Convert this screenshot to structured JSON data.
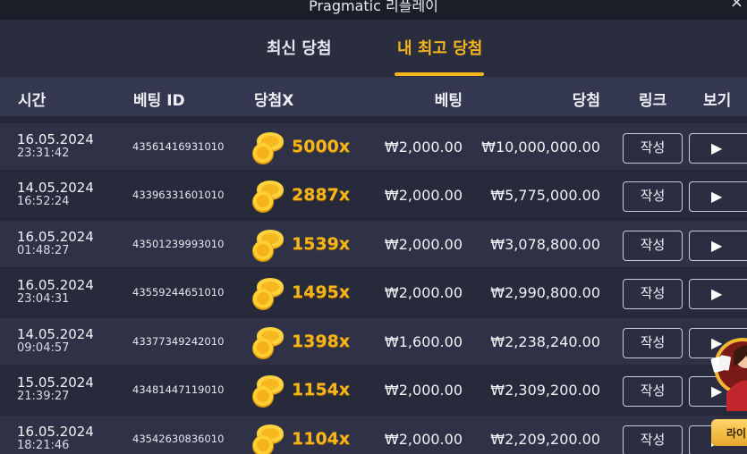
{
  "window": {
    "title": "Pragmatic 리플레이",
    "close_glyph": "×"
  },
  "tabs": [
    {
      "label": "최신 당첨",
      "active": false
    },
    {
      "label": "내 최고 당첨",
      "active": true
    }
  ],
  "columns": {
    "time": "시간",
    "bet_id": "베팅 ID",
    "multiplier": "당첨X",
    "bet": "베팅",
    "win": "당첨",
    "link": "링크",
    "view": "보기"
  },
  "rows": [
    {
      "date": "16.05.2024",
      "time": "23:31:42",
      "bet_id": "43561416931010",
      "multiplier": "5000x",
      "bet": "₩2,000.00",
      "win": "₩10,000,000.00",
      "link_label": "작성",
      "play_icon": "▶"
    },
    {
      "date": "14.05.2024",
      "time": "16:52:24",
      "bet_id": "43396331601010",
      "multiplier": "2887x",
      "bet": "₩2,000.00",
      "win": "₩5,775,000.00",
      "link_label": "작성",
      "play_icon": "▶"
    },
    {
      "date": "16.05.2024",
      "time": "01:48:27",
      "bet_id": "43501239993010",
      "multiplier": "1539x",
      "bet": "₩2,000.00",
      "win": "₩3,078,800.00",
      "link_label": "작성",
      "play_icon": "▶"
    },
    {
      "date": "16.05.2024",
      "time": "23:04:31",
      "bet_id": "43559244651010",
      "multiplier": "1495x",
      "bet": "₩2,000.00",
      "win": "₩2,990,800.00",
      "link_label": "작성",
      "play_icon": "▶"
    },
    {
      "date": "14.05.2024",
      "time": "09:04:57",
      "bet_id": "43377349242010",
      "multiplier": "1398x",
      "bet": "₩1,600.00",
      "win": "₩2,238,240.00",
      "link_label": "작성",
      "play_icon": "▶"
    },
    {
      "date": "15.05.2024",
      "time": "21:39:27",
      "bet_id": "43481447119010",
      "multiplier": "1154x",
      "bet": "₩2,000.00",
      "win": "₩2,309,200.00",
      "link_label": "작성",
      "play_icon": "▶"
    },
    {
      "date": "16.05.2024",
      "time": "18:21:46",
      "bet_id": "43542630836010",
      "multiplier": "1104x",
      "bet": "₩2,000.00",
      "win": "₩2,209,200.00",
      "link_label": "작성",
      "play_icon": "▶"
    }
  ],
  "live_widget": {
    "label": "라이"
  },
  "colors": {
    "accent": "#f5b51b",
    "background": "#252838",
    "header": "#343750"
  }
}
